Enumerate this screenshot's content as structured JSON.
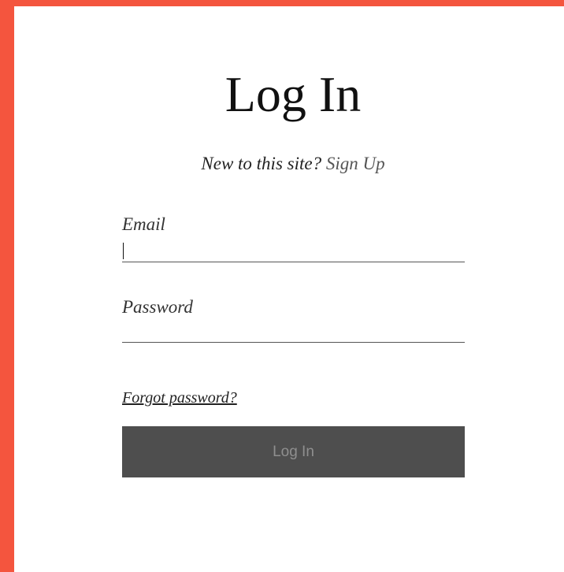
{
  "login_form": {
    "title": "Log In",
    "subtitle_prefix": "New to this site?",
    "signup_link": "Sign Up",
    "email": {
      "label": "Email",
      "value": ""
    },
    "password": {
      "label": "Password",
      "value": ""
    },
    "forgot_password_link": "Forgot password?",
    "submit_label": "Log In"
  },
  "colors": {
    "background_accent": "#f4553e",
    "panel": "#ffffff",
    "button_background": "#4e4e4e",
    "button_text": "#8f8f8f",
    "text": "#111111"
  }
}
